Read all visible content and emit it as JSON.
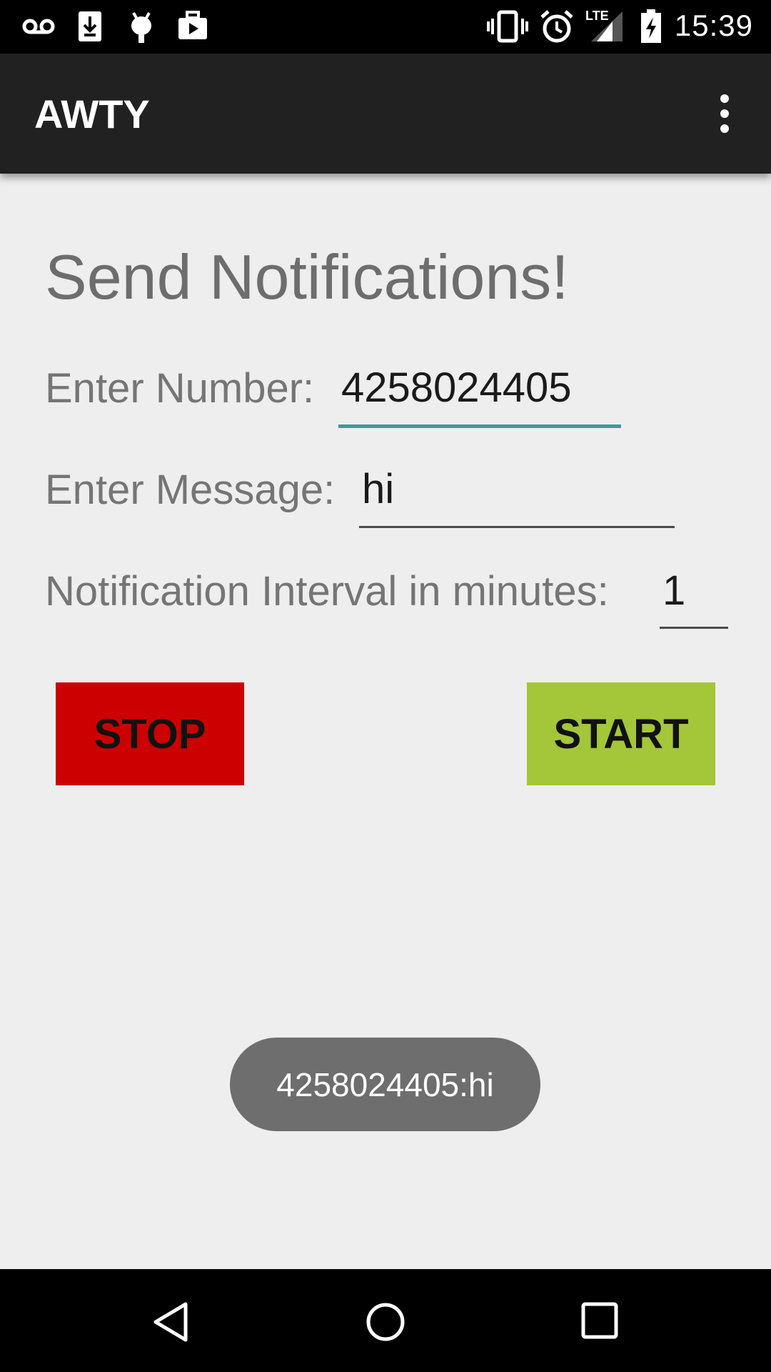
{
  "status_bar": {
    "time": "15:39",
    "left_icons": [
      "voicemail-icon",
      "download-icon",
      "android-debug-icon",
      "media-icon"
    ],
    "right_icons": [
      "vibrate-icon",
      "alarm-icon",
      "lte-signal-icon",
      "battery-charging-icon"
    ],
    "network_label": "LTE"
  },
  "app_bar": {
    "title": "AWTY",
    "menu_icon": "more-vert-icon"
  },
  "main": {
    "heading": "Send Notifications!",
    "number_label": "Enter Number:",
    "number_value": "4258024405",
    "message_label": "Enter Message:",
    "message_value": "hi",
    "interval_label": "Notification Interval in minutes:",
    "interval_value": "1",
    "stop_label": "STOP",
    "start_label": "START"
  },
  "toast": {
    "text": "4258024405:hi"
  },
  "colors": {
    "stop": "#cc0000",
    "start": "#a4c639",
    "focus_underline": "#3d9c96",
    "app_bar": "#212121",
    "background": "#eeeeee"
  },
  "nav_bar": {
    "icons": [
      "back-icon",
      "home-icon",
      "recents-icon"
    ]
  }
}
